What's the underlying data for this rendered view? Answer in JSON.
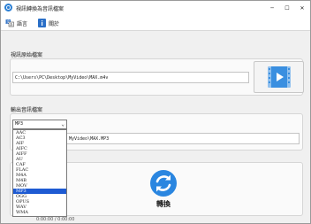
{
  "window": {
    "title": "視訊轉換為音訊檔案",
    "controls": {
      "minimize": "─",
      "maximize": "☐",
      "close": "✕"
    }
  },
  "menu": {
    "items": [
      {
        "label": "語言",
        "icon": "language-icon"
      },
      {
        "label": "關於",
        "icon": "info-icon"
      }
    ]
  },
  "source": {
    "label": "視訊原始檔案",
    "path": "C:\\Users\\PC\\Desktop\\MyVideo\\MAX.m4v",
    "button_icon": "video-file-icon"
  },
  "output": {
    "label": "輸出音訊檔案",
    "path_visible": "MyVideo\\MAX.MP3",
    "format_selected": "MP3",
    "format_options": [
      "AAC",
      "AC3",
      "AIF",
      "AIFC",
      "AIFF",
      "AU",
      "CAF",
      "FLAC",
      "M4A",
      "M4B",
      "MOV",
      "MP3",
      "OGG",
      "OPUS",
      "WAV",
      "WMA"
    ]
  },
  "convert": {
    "label": "轉換",
    "icon": "refresh-icon"
  },
  "status": {
    "text": "0:00:00 / 0:00:00"
  },
  "colors": {
    "accent": "#2a7fd4",
    "selection": "#1e5bd3"
  }
}
